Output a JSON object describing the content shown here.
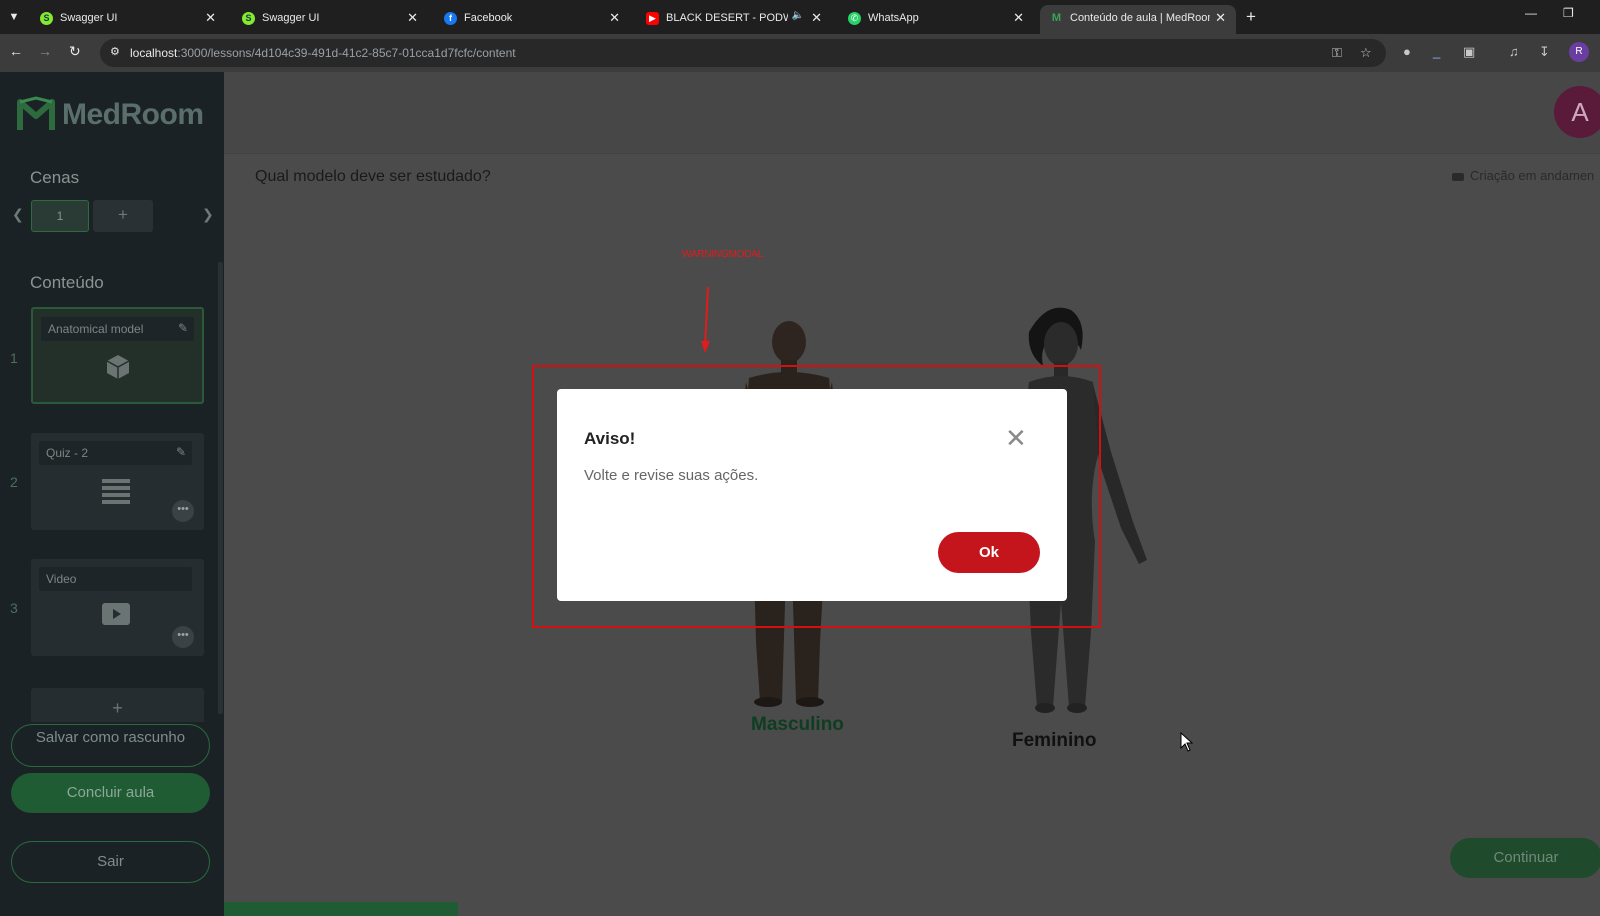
{
  "browser": {
    "tabs": [
      {
        "title": "Swagger UI",
        "icon": "swagger-icon",
        "color": "#85ea2d"
      },
      {
        "title": "Swagger UI",
        "icon": "swagger-icon",
        "color": "#85ea2d"
      },
      {
        "title": "Facebook",
        "icon": "facebook-icon",
        "color": "#1877f2"
      },
      {
        "title": "BLACK DESERT - PODWAR I",
        "icon": "youtube-icon",
        "color": "#ff0000"
      },
      {
        "title": "WhatsApp",
        "icon": "whatsapp-icon",
        "color": "#25d366"
      },
      {
        "title": "Conteúdo de aula | MedRoom",
        "icon": "medroom-icon",
        "color": "#3aa35a"
      }
    ],
    "url_host": "localhost",
    "url_path": ":3000/lessons/4d104c39-491d-41c2-85c7-01cca1d7fcfc/content",
    "profile_initial": "R"
  },
  "sidebar": {
    "logo_text": "MedRoom",
    "scenes_title": "Cenas",
    "scene_chip": "1",
    "scene_add": "+",
    "content_title": "Conteúdo",
    "cards": [
      {
        "number": "1",
        "label": "Anatomical model",
        "icon": "cube-icon"
      },
      {
        "number": "2",
        "label": "Quiz - 2",
        "icon": "list-icon"
      },
      {
        "number": "3",
        "label": "Video",
        "icon": "play-icon"
      }
    ],
    "add_card": "+",
    "save_draft": "Salvar como rascunho",
    "finish_lesson": "Concluir aula",
    "exit": "Sair"
  },
  "main": {
    "avatar_initial": "A",
    "question": "Qual modelo deve ser estudado?",
    "status": "Criação em andamen",
    "male_label": "Masculino",
    "female_label": "Feminino",
    "continue": "Continuar"
  },
  "annotation": {
    "label": "WARNINGMODAL",
    "color": "#e21b1b"
  },
  "modal": {
    "title": "Aviso!",
    "message": "Volte e revise suas ações.",
    "ok": "Ok",
    "ok_color": "#c4141c"
  }
}
